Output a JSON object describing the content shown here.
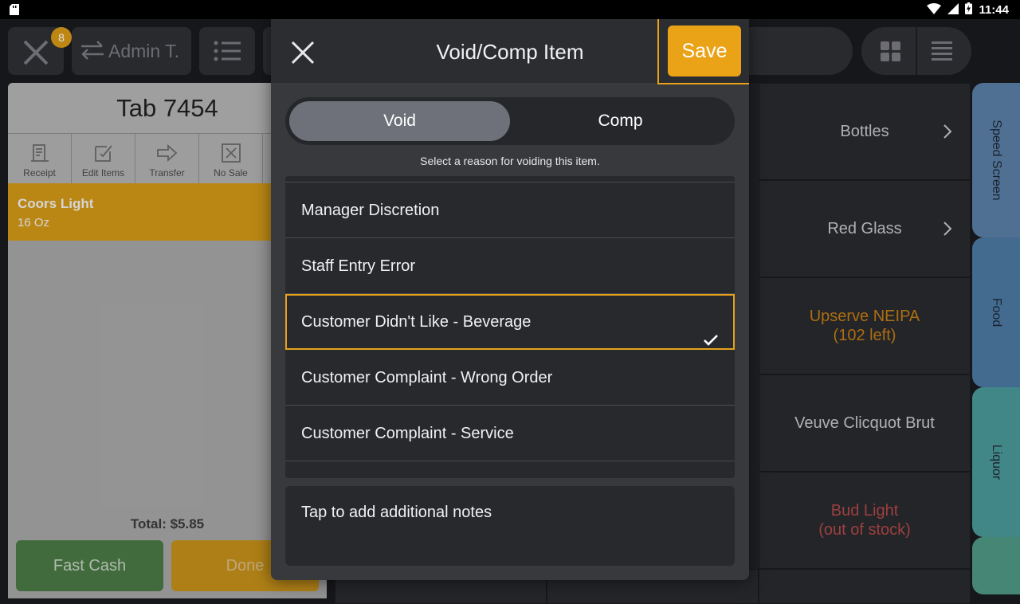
{
  "status_bar": {
    "time": "11:44"
  },
  "topbar": {
    "badge_count": "8",
    "employee_label": "Admin T."
  },
  "order": {
    "title": "Tab 7454",
    "actions": [
      {
        "label": "Receipt",
        "icon": "receipt-icon"
      },
      {
        "label": "Edit Items",
        "icon": "edit-items-icon"
      },
      {
        "label": "Transfer",
        "icon": "transfer-icon"
      },
      {
        "label": "No Sale",
        "icon": "no-sale-icon"
      }
    ],
    "items": [
      {
        "name": "Coors Light",
        "modifier": "16 Oz"
      }
    ],
    "total": "Total: $5.85",
    "fast_cash_label": "Fast Cash",
    "done_label": "Done"
  },
  "menu_cells": [
    {
      "label": "Bottles",
      "sub": "",
      "style": "normal",
      "has_chevron": true
    },
    {
      "label": "Red Glass",
      "sub": "",
      "style": "normal",
      "has_chevron": true
    },
    {
      "label": "Upserve NEIPA",
      "sub": "(102 left)",
      "style": "orange",
      "has_chevron": false
    },
    {
      "label": "Veuve Clicquot Brut",
      "sub": "",
      "style": "normal",
      "has_chevron": false
    },
    {
      "label": "Bud Light",
      "sub": "(out of stock)",
      "style": "red",
      "has_chevron": false
    }
  ],
  "side_tabs": [
    {
      "label": "Speed Screen",
      "color": "#5a7fa8"
    },
    {
      "label": "Food",
      "color": "#4d7aa4"
    },
    {
      "label": "Liquor",
      "color": "#4b9a9a"
    },
    {
      "label": "",
      "color": "#4f9a84"
    }
  ],
  "modal": {
    "title": "Void/Comp Item",
    "save_label": "Save",
    "segment": {
      "options": [
        "Void",
        "Comp"
      ],
      "selected": "Void"
    },
    "instruction": "Select a reason for voiding this item.",
    "reasons": [
      {
        "label": "Manager Discretion",
        "selected": false
      },
      {
        "label": "Staff Entry Error",
        "selected": false
      },
      {
        "label": "Customer Didn't Like - Beverage",
        "selected": true
      },
      {
        "label": "Customer Complaint - Wrong Order",
        "selected": false
      },
      {
        "label": "Customer Complaint - Service",
        "selected": false
      }
    ],
    "notes_placeholder": "Tap to add additional notes"
  },
  "colors": {
    "accent": "#eaa317",
    "selection_border": "#e7a21a",
    "order_item_bg": "#d49a18",
    "fast_cash_bg": "#4b7a45"
  }
}
